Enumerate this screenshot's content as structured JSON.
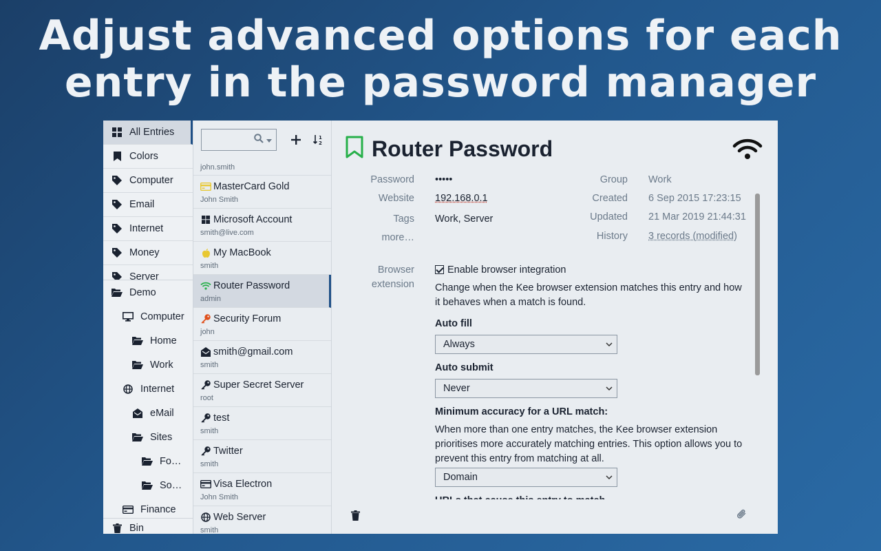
{
  "headline": {
    "line1": "Adjust advanced options for each",
    "line2": "entry in the password manager"
  },
  "menu": {
    "top_items": [
      {
        "label": "All Entries",
        "icon": "grid-icon"
      },
      {
        "label": "Colors",
        "icon": "bookmark-icon"
      },
      {
        "label": "Computer",
        "icon": "tag-icon"
      },
      {
        "label": "Email",
        "icon": "tag-icon"
      },
      {
        "label": "Internet",
        "icon": "tag-icon"
      },
      {
        "label": "Money",
        "icon": "tag-icon"
      },
      {
        "label": "Server",
        "icon": "tag-icon"
      }
    ],
    "tree": [
      {
        "label": "Demo",
        "icon": "folder-open-icon"
      },
      {
        "label": "Computer",
        "icon": "desktop-icon"
      },
      {
        "label": "Home",
        "icon": "folder-open-icon"
      },
      {
        "label": "Work",
        "icon": "folder-open-icon"
      },
      {
        "label": "Internet",
        "icon": "globe-icon"
      },
      {
        "label": "eMail",
        "icon": "envelope-open-icon"
      },
      {
        "label": "Sites",
        "icon": "folder-open-icon"
      },
      {
        "label": "Fo…",
        "icon": "folder-open-icon"
      },
      {
        "label": "So…",
        "icon": "folder-open-icon"
      },
      {
        "label": "Finance",
        "icon": "credit-card-icon"
      }
    ],
    "bin_label": "Bin"
  },
  "list": {
    "partial_user": "john.smith",
    "entries": [
      {
        "title": "MasterCard Gold",
        "user": "John Smith",
        "icon": "credit-card-icon",
        "icon_color": "#e8c832"
      },
      {
        "title": "Microsoft Account",
        "user": "smith@live.com",
        "icon": "windows-icon",
        "icon_color": "#1a2230"
      },
      {
        "title": "My MacBook",
        "user": "smith",
        "icon": "apple-icon",
        "icon_color": "#e8c832"
      },
      {
        "title": "Router Password",
        "user": "admin",
        "icon": "wifi-icon",
        "icon_color": "#27b04a"
      },
      {
        "title": "Security Forum",
        "user": "john",
        "icon": "key-icon",
        "icon_color": "#e0501c"
      },
      {
        "title": "smith@gmail.com",
        "user": "smith",
        "icon": "envelope-open-icon",
        "icon_color": "#1a2230"
      },
      {
        "title": "Super Secret Server",
        "user": "root",
        "icon": "key-icon",
        "icon_color": "#1a2230"
      },
      {
        "title": "test",
        "user": "smith",
        "icon": "key-icon",
        "icon_color": "#1a2230"
      },
      {
        "title": "Twitter",
        "user": "smith",
        "icon": "key-icon",
        "icon_color": "#1a2230"
      },
      {
        "title": "Visa Electron",
        "user": "John Smith",
        "icon": "credit-card-icon",
        "icon_color": "#1a2230"
      },
      {
        "title": "Web Server",
        "user": "smith",
        "icon": "globe-icon",
        "icon_color": "#1a2230"
      }
    ]
  },
  "details": {
    "title": "Router Password",
    "fields_left": {
      "password_label": "Password",
      "password_value": "•••••",
      "website_label": "Website",
      "website_value": "192.168.0.1",
      "tags_label": "Tags",
      "tags_value": "Work, Server",
      "more_label": "more…"
    },
    "fields_right": {
      "group_label": "Group",
      "group_value": "Work",
      "created_label": "Created",
      "created_value": "6 Sep 2015 17:23:15",
      "updated_label": "Updated",
      "updated_value": "21 Mar 2019 21:44:31",
      "history_label": "History",
      "history_value": "3 records (modified)"
    },
    "browser": {
      "label_line1": "Browser",
      "label_line2": "extension",
      "enable_label": "Enable browser integration",
      "description": "Change when the Kee browser extension matches this entry and how it behaves when a match is found.",
      "autofill_label": "Auto fill",
      "autofill_value": "Always",
      "autosubmit_label": "Auto submit",
      "autosubmit_value": "Never",
      "accuracy_label": "Minimum accuracy for a URL match:",
      "accuracy_desc": "When more than one entry matches, the Kee browser extension prioritises more accurately matching entries. This option allows you to prevent this entry from matching at all.",
      "accuracy_value": "Domain",
      "urls_label": "URLs that cause this entry to match"
    }
  },
  "colors": {
    "accent": "#1e4f86",
    "bookmark_green": "#27b04a",
    "selected_bg": "#d3d9e1"
  }
}
